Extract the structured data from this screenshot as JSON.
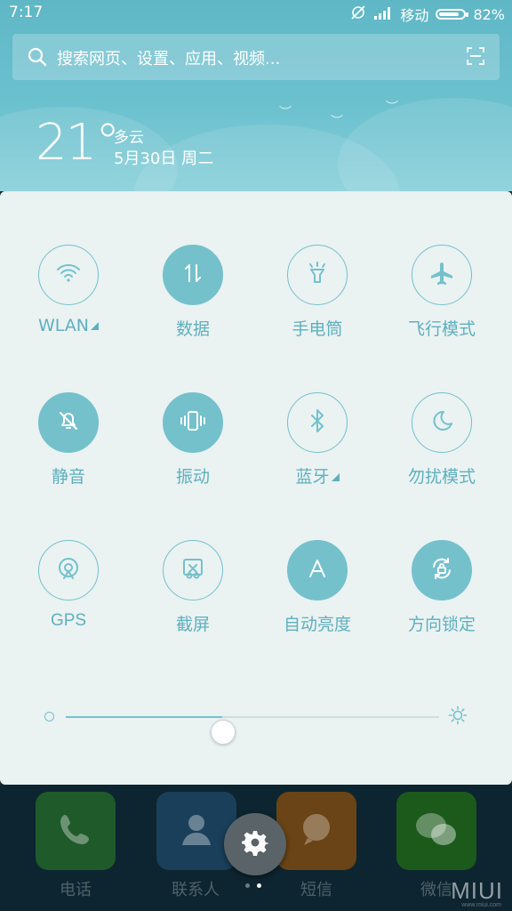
{
  "status_bar": {
    "time": "7:17",
    "carrier": "移动",
    "battery": "82%",
    "battery_level": 0.82
  },
  "search": {
    "placeholder": "搜索网页、设置、应用、视频..."
  },
  "weather": {
    "temperature": "21°",
    "condition": "多云",
    "date": "5月30日 周二"
  },
  "tiles": [
    {
      "label": "WLAN",
      "icon": "wifi-icon",
      "on": false,
      "has_more": true
    },
    {
      "label": "数据",
      "icon": "data-arrows-icon",
      "on": true,
      "has_more": false
    },
    {
      "label": "手电筒",
      "icon": "flashlight-icon",
      "on": false,
      "has_more": false
    },
    {
      "label": "飞行模式",
      "icon": "airplane-icon",
      "on": false,
      "has_more": false
    },
    {
      "label": "静音",
      "icon": "bell-muted-icon",
      "on": true,
      "has_more": false
    },
    {
      "label": "振动",
      "icon": "vibrate-icon",
      "on": true,
      "has_more": false
    },
    {
      "label": "蓝牙",
      "icon": "bluetooth-icon",
      "on": false,
      "has_more": true
    },
    {
      "label": "勿扰模式",
      "icon": "moon-icon",
      "on": false,
      "has_more": false
    },
    {
      "label": "GPS",
      "icon": "gps-icon",
      "on": false,
      "has_more": false
    },
    {
      "label": "截屏",
      "icon": "screenshot-icon",
      "on": false,
      "has_more": false
    },
    {
      "label": "自动亮度",
      "icon": "auto-brightness-icon",
      "on": true,
      "has_more": false
    },
    {
      "label": "方向锁定",
      "icon": "rotation-lock-icon",
      "on": true,
      "has_more": false
    }
  ],
  "brightness": {
    "level": 0.42
  },
  "dock": {
    "apps": [
      {
        "label": "电话",
        "icon": "phone-icon",
        "color": "#1f5a2a"
      },
      {
        "label": "联系人",
        "icon": "contacts-icon",
        "color": "#1a3f5a"
      },
      {
        "label": "短信",
        "icon": "messages-icon",
        "color": "#6a4416"
      },
      {
        "label": "微信",
        "icon": "wechat-icon",
        "color": "#1b5a1b"
      }
    ]
  },
  "watermark": {
    "brand": "MIUI",
    "url": "www.miui.com"
  },
  "colors": {
    "accent": "#74c1cc",
    "panel_bg": "#eaf2f2",
    "header_bg": "#6cc1cf"
  }
}
